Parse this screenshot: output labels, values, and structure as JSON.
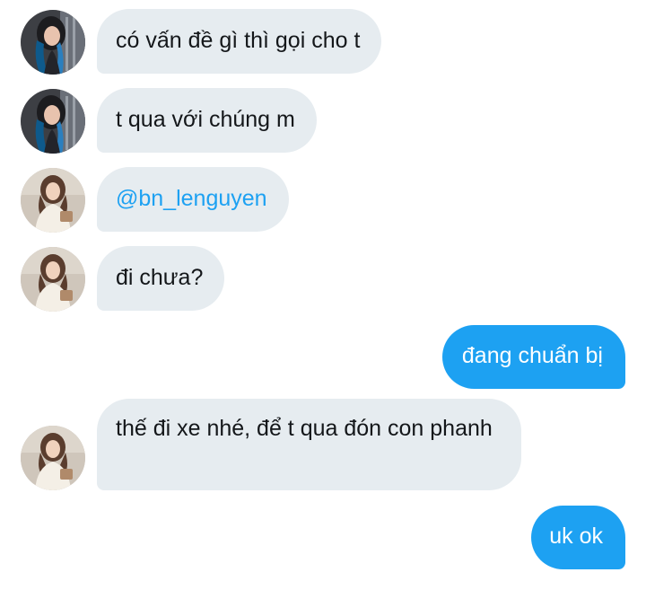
{
  "conversation": {
    "messages": [
      {
        "direction": "incoming",
        "sender": "other",
        "text": "có vấn đề gì thì gọi cho t"
      },
      {
        "direction": "incoming",
        "sender": "other",
        "text": "t qua với chúng m"
      },
      {
        "direction": "incoming",
        "sender": "friend",
        "text": "@bn_lenguyen",
        "is_mention": true
      },
      {
        "direction": "incoming",
        "sender": "friend",
        "text": "đi chưa?"
      },
      {
        "direction": "outgoing",
        "sender": "me",
        "text": "đang chuẩn bị"
      },
      {
        "direction": "incoming",
        "sender": "friend",
        "text": "thế đi xe nhé, để t qua đón con phanh"
      },
      {
        "direction": "outgoing",
        "sender": "me",
        "text": "uk ok"
      }
    ]
  },
  "colors": {
    "incoming_bubble": "#e6ecf0",
    "outgoing_bubble": "#1da1f2",
    "mention": "#1da1f2",
    "text": "#14171a"
  }
}
